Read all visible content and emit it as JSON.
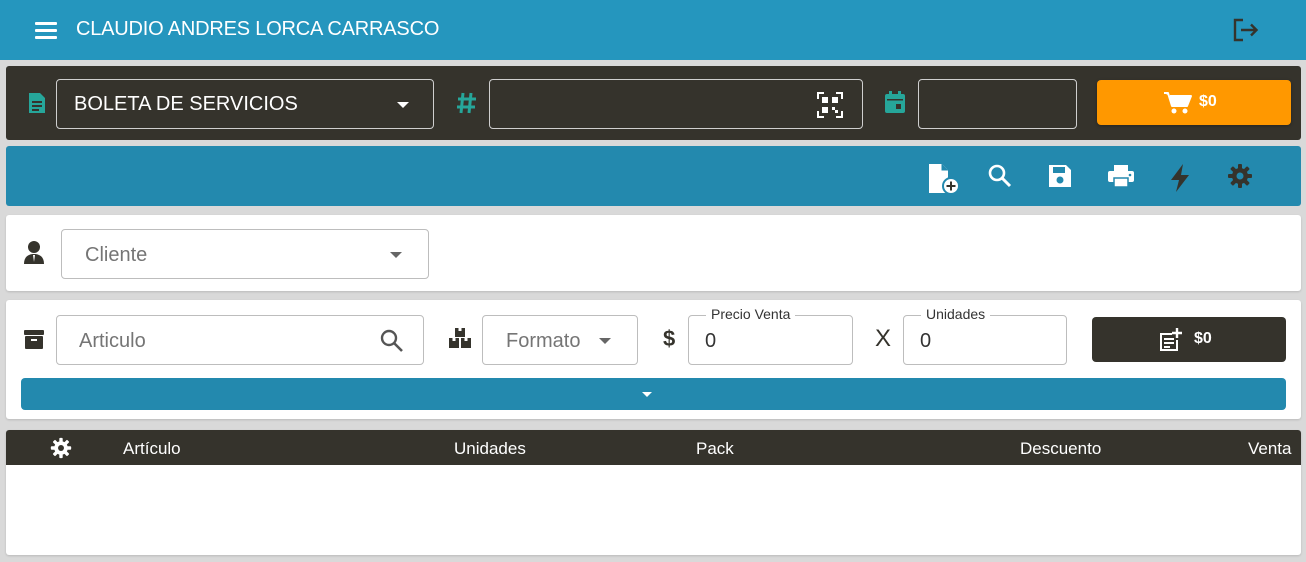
{
  "app": {
    "user_name": "CLAUDIO ANDRES LORCA CARRASCO",
    "menu_icon": "hamburger-menu-icon",
    "logout_icon": "logout-icon",
    "accent_color": "#2596be"
  },
  "document": {
    "type_value": "BOLETA DE SERVICIOS",
    "folio_value": "",
    "date_value": "",
    "cart_total": "$0",
    "cart_color": "#ff9800"
  },
  "toolbar": {
    "actions": [
      "new-document-icon",
      "search-icon",
      "save-icon",
      "print-icon",
      "flash-icon",
      "settings-icon"
    ]
  },
  "client": {
    "placeholder": "Cliente"
  },
  "item": {
    "article_placeholder": "Articulo",
    "format_placeholder": "Formato",
    "currency_symbol": "$",
    "times_symbol": "X",
    "price_label": "Precio Venta",
    "price_value": "0",
    "units_label": "Unidades",
    "units_value": "0",
    "add_total": "$0"
  },
  "table": {
    "columns": [
      "Artículo",
      "Unidades",
      "Pack",
      "Descuento",
      "Venta"
    ],
    "rows": []
  }
}
